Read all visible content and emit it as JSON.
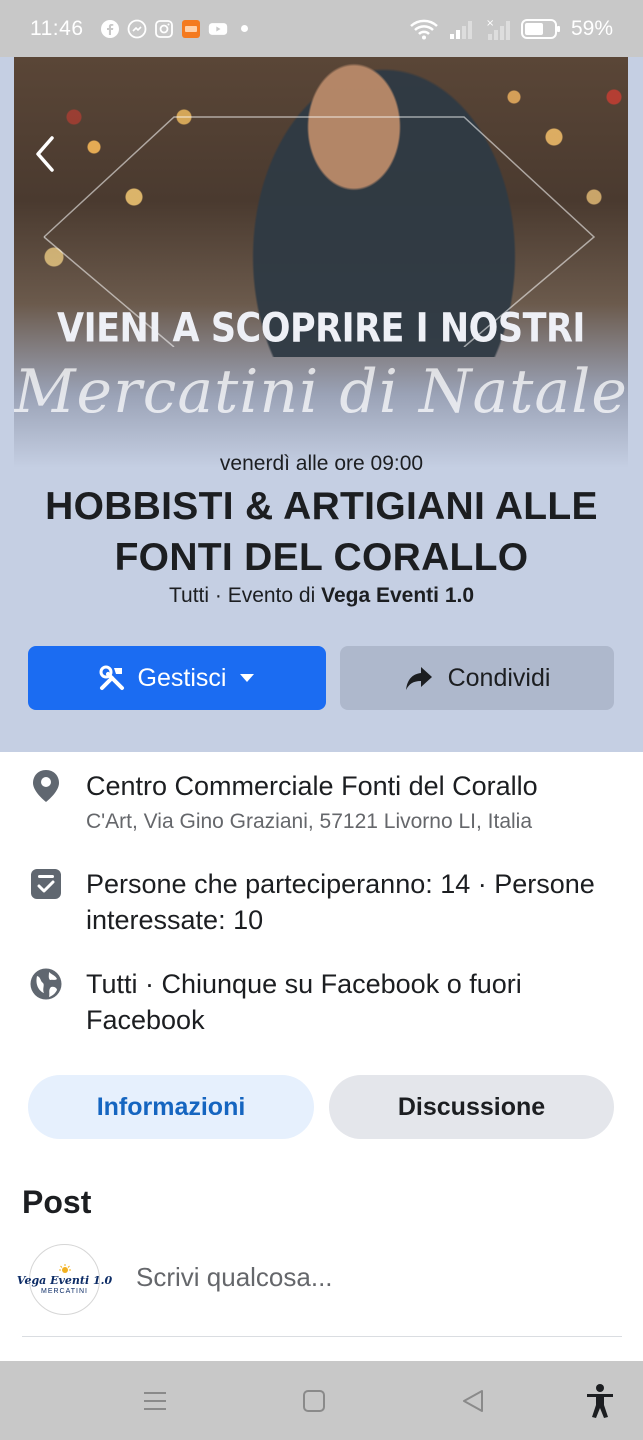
{
  "status_bar": {
    "time": "11:46",
    "battery_percent": "59%",
    "apps": [
      "facebook-icon",
      "messenger-icon",
      "instagram-icon",
      "temu-icon",
      "youtube-icon"
    ]
  },
  "hero": {
    "headline": "VIENI A SCOPRIRE I NOSTRI",
    "script_text": "Mercatini di Natale"
  },
  "event": {
    "date": "venerdì alle ore 09:00",
    "title": "HOBBISTI & ARTIGIANI ALLE FONTI DEL CORALLO",
    "audience": "Tutti · Evento di ",
    "organizer": "Vega Eventi 1.0"
  },
  "actions": {
    "manage_label": "Gestisci",
    "share_label": "Condividi"
  },
  "details": {
    "location_name": "Centro Commerciale Fonti del Corallo",
    "location_address": "C'Art, Via Gino Graziani, 57121 Livorno LI, Italia",
    "attendance": "Persone che parteciperanno: 14 · Persone interessate: 10",
    "privacy": "Tutti · Chiunque su Facebook o fuori Facebook"
  },
  "tabs": {
    "info": "Informazioni",
    "discussion": "Discussione"
  },
  "posts": {
    "heading": "Post",
    "composer_placeholder": "Scrivi qualcosa...",
    "avatar_name": "Vega Eventi 1.0",
    "avatar_subtitle": "MERCATINI"
  },
  "colors": {
    "primary": "#1b6cf2",
    "hero_bg": "#c5cfe3",
    "tab_active_bg": "#e6f0fd",
    "tab_active_text": "#1565c0"
  }
}
